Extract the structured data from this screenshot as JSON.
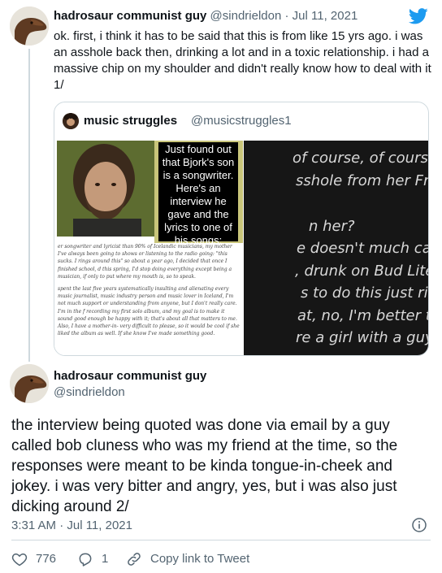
{
  "tweet1": {
    "author_name": "hadrosaur communist guy",
    "author_handle": "@sindrieldon",
    "date": "Jul 11, 2021",
    "separator": "·",
    "text": "ok. first, i think it has to be said that this is from like 15 yrs ago. i was an asshole back then, drinking a lot and in a toxic relationship. i had a massive chip on my shoulder and didn't really know how to deal with it 1/",
    "brand_icon": "twitter-bird-icon",
    "brand_color": "#1d9bf0"
  },
  "quote": {
    "author_name": "music struggles",
    "author_handle": "@musicstruggles1",
    "caption": "Just found out\nthat Bjork's son\nis a songwriter.\nHere's an\ninterview he\ngave and the\nlyrics to one of\nhis songs:",
    "article_paragraphs": [
      "er songwriter and lyricist than 90% of Icelandic musicians, my mother I've always been going to shows or listening to the radio going: \"this sucks. I rings around this\" so about a year ago, I decided that once I finished school, d this spring, I'd stop doing everything except being a musician, if only to put where my mouth is, so to speak.",
      "spent the last five years systematically insulting and alienating every music journalist, music industry person and music lover in Iceland, I'm not much support or understanding from anyone, but I don't really care. I'm in the f recording my first solo album, and my goal is to make it sound good enough be happy with it; that's about all that matters to me. Also, I have a mother-in- very difficult to please, so it would be cool if she liked the album as well. If she know I've made something good."
    ],
    "lyrics": [
      "of course, of course",
      "sshole from her French",
      "n her?",
      "e doesn't much care",
      ", drunk on Bud Lite",
      "s to do this just right",
      "at, no, I'm better than that",
      "re a girl with a guy like tha"
    ]
  },
  "tweet2": {
    "author_name": "hadrosaur communist guy",
    "author_handle": "@sindrieldon",
    "text": "the interview being quoted was done via email by a guy called bob cluness who was my friend at the time, so the responses were meant to be kinda tongue-in-cheek and jokey. i was very bitter and angry, yes, but i was also just dicking around 2/",
    "timestamp": "3:31 AM · Jul 11, 2021",
    "likes": "776",
    "replies": "1",
    "copy_link_label": "Copy link to Tweet",
    "icons": [
      "heart-icon",
      "reply-bubble-icon",
      "link-icon",
      "info-icon"
    ]
  }
}
